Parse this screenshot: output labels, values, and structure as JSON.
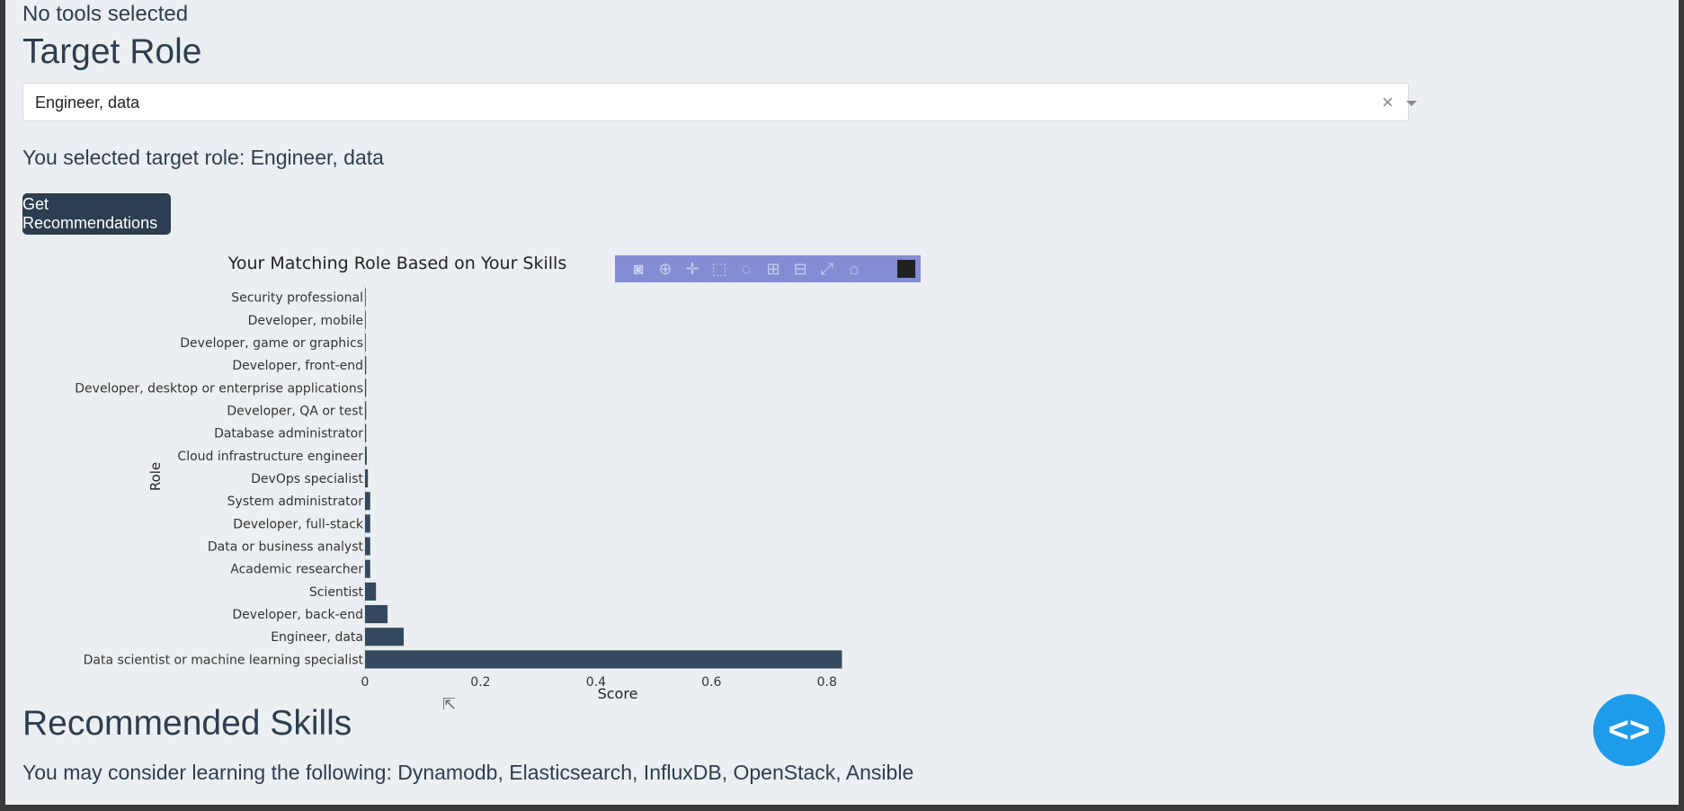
{
  "status": {
    "tools": "No tools selected"
  },
  "target_role": {
    "heading": "Target Role",
    "dropdown_value": "Engineer, data",
    "clear_symbol": "×",
    "selected_message": "You selected target role: Engineer, data"
  },
  "button": {
    "label": "Get Recommendations"
  },
  "chart_data": {
    "type": "bar",
    "orientation": "horizontal",
    "title": "Your Matching Role Based on Your Skills",
    "xlabel": "Score",
    "ylabel": "Role",
    "xlim": [
      0,
      0.83
    ],
    "xticks": [
      0,
      0.2,
      0.4,
      0.6,
      0.8
    ],
    "xtick_labels": [
      "0",
      "0.2",
      "0.4",
      "0.6",
      "0.8"
    ],
    "bar_color": "#34495e",
    "categories": [
      "Security professional",
      "Developer, mobile",
      "Developer, game or graphics",
      "Developer, front-end",
      "Developer, desktop or enterprise applications",
      "Developer, QA or test",
      "Database administrator",
      "Cloud infrastructure engineer",
      "DevOps specialist",
      "System administrator",
      "Developer, full-stack",
      "Data or business analyst",
      "Academic researcher",
      "Scientist",
      "Developer, back-end",
      "Engineer, data",
      "Data scientist or machine learning specialist"
    ],
    "values": [
      0.001,
      0.001,
      0.001,
      0.002,
      0.002,
      0.002,
      0.002,
      0.003,
      0.005,
      0.009,
      0.009,
      0.009,
      0.009,
      0.019,
      0.039,
      0.067,
      0.826
    ]
  },
  "modebar": {
    "icons": [
      "camera-icon",
      "zoom-icon",
      "pan-icon",
      "box-select-icon",
      "lasso-icon",
      "zoom-in-icon",
      "zoom-out-icon",
      "autoscale-icon",
      "reset-axes-icon"
    ],
    "logo": "plotly-logo"
  },
  "skills": {
    "heading": "Recommended Skills",
    "text": "You may consider learning the following: Dynamodb, Elasticsearch, InfluxDB, OpenStack, Ansible"
  },
  "code_toggle": {
    "left": "<",
    "right": ">"
  }
}
